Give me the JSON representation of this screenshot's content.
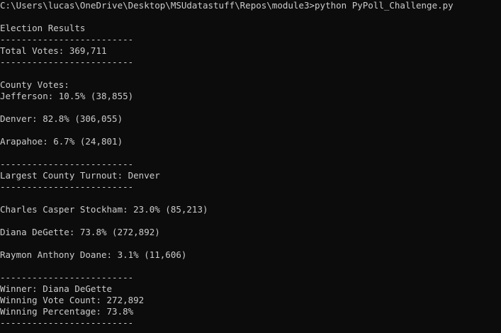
{
  "terminal": {
    "lines": [
      "C:\\Users\\lucas\\OneDrive\\Desktop\\MSUdatastuff\\Repos\\module3>python PyPoll_Challenge.py",
      "",
      "Election Results",
      "-------------------------",
      "Total Votes: 369,711",
      "-------------------------",
      "",
      "County Votes:",
      "Jefferson: 10.5% (38,855)",
      "",
      "Denver: 82.8% (306,055)",
      "",
      "Arapahoe: 6.7% (24,801)",
      "",
      "-------------------------",
      "Largest County Turnout: Denver",
      "-------------------------",
      "",
      "Charles Casper Stockham: 23.0% (85,213)",
      "",
      "Diana DeGette: 73.8% (272,892)",
      "",
      "Raymon Anthony Doane: 3.1% (11,606)",
      "",
      "-------------------------",
      "Winner: Diana DeGette",
      "Winning Vote Count: 272,892",
      "Winning Percentage: 73.8%",
      "-------------------------"
    ]
  }
}
